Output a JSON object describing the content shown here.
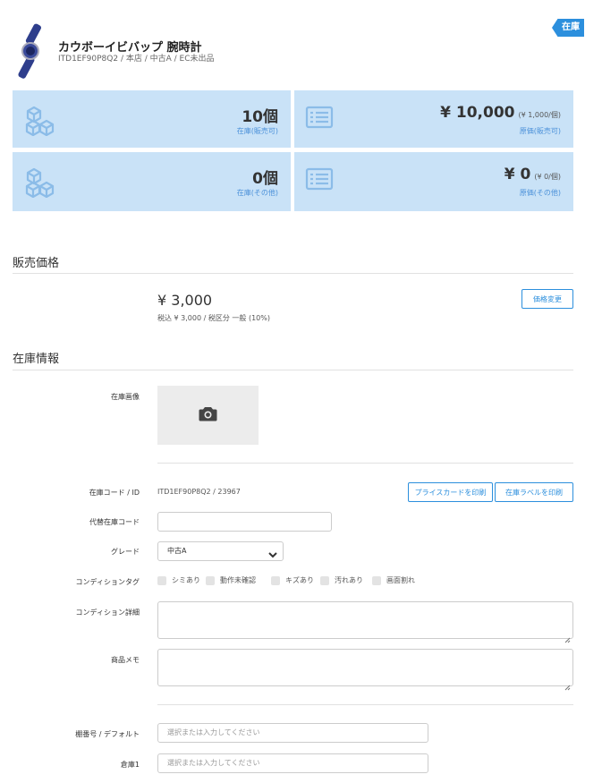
{
  "status_badge": "在庫",
  "product": {
    "title": "カウボーイビバップ 腕時計",
    "subtitle": "ITD1EF90P8Q2 / 本店 / 中古A / EC未出品"
  },
  "summary": {
    "stock_sellable": {
      "value": "10個",
      "label": "在庫(販売可)"
    },
    "cost_sellable": {
      "value": "¥ 10,000",
      "unit": "(¥ 1,000/個)",
      "label": "原価(販売可)"
    },
    "stock_other": {
      "value": "0個",
      "label": "在庫(その他)"
    },
    "cost_other": {
      "value": "¥ 0",
      "unit": "(¥ 0/個)",
      "label": "原価(その他)"
    }
  },
  "price_section": {
    "heading": "販売価格",
    "price": "¥ 3,000",
    "tax_note": "税込 ¥ 3,000 / 税区分 一般 (10%)",
    "change_button": "価格変更"
  },
  "stock_section": {
    "heading": "在庫情報",
    "image_label": "在庫画像",
    "code_label": "在庫コード / ID",
    "code_value": "ITD1EF90P8Q2 / 23967",
    "print_price_card": "プライスカードを印刷",
    "print_stock_label": "在庫ラベルを印刷",
    "alt_code_label": "代替在庫コード",
    "alt_code_value": "",
    "grade_label": "グレード",
    "grade_value": "中古A",
    "condition_tag_label": "コンディションタグ",
    "condition_tags": [
      "シミあり",
      "動作未確認",
      "キズあり",
      "汚れあり",
      "画面割れ"
    ],
    "condition_detail_label": "コンディション詳細",
    "memo_label": "商品メモ",
    "shelf_label": "棚番号 / デフォルト",
    "shelf_placeholder": "選択または入力してください",
    "warehouse_label": "倉庫1",
    "warehouse_placeholder": "選択または入力してください"
  }
}
